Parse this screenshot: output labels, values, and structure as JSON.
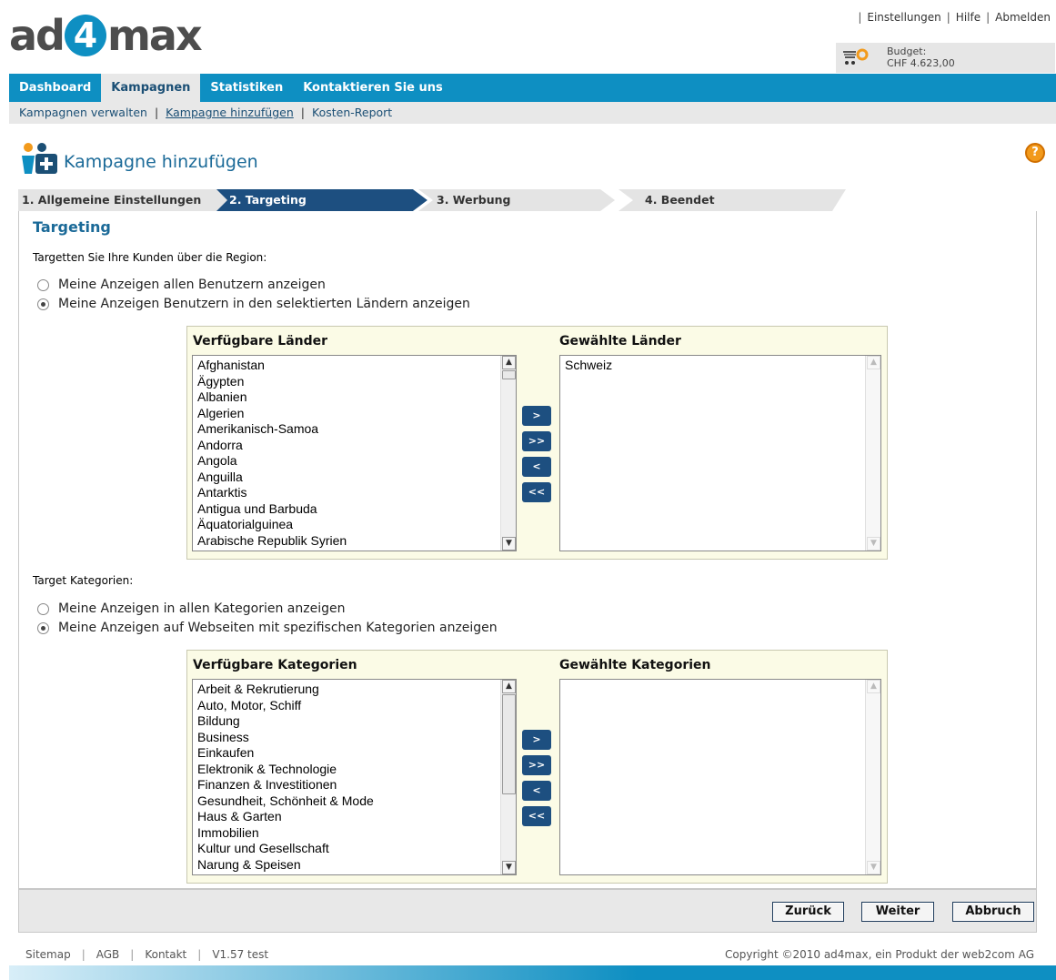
{
  "header": {
    "logo": {
      "pre": "ad",
      "mid": "4",
      "post": "max"
    },
    "toplinks": [
      "Einstellungen",
      "Hilfe",
      "Abmelden"
    ],
    "budget_label": "Budget:",
    "budget_value": "CHF 4.623,00"
  },
  "nav": {
    "items": [
      "Dashboard",
      "Kampagnen",
      "Statistiken",
      "Kontaktieren Sie uns"
    ],
    "active": "Kampagnen"
  },
  "subnav": {
    "items": [
      "Kampagnen verwalten",
      "Kampagne hinzufügen",
      "Kosten-Report"
    ]
  },
  "page": {
    "title": "Kampagne hinzufügen",
    "help": "?"
  },
  "steps": [
    "1. Allgemeine Einstellungen",
    "2. Targeting",
    "3. Werbung",
    "4. Beendet"
  ],
  "targeting": {
    "section_title": "Targeting",
    "region_label": "Targetten Sie Ihre Kunden über die Region:",
    "region_options": [
      "Meine Anzeigen allen Benutzern anzeigen",
      "Meine Anzeigen Benutzern in den selektierten Ländern anzeigen"
    ],
    "countries_available_header": "Verfügbare Länder",
    "countries_selected_header": "Gewählte Länder",
    "countries_available": [
      "Afghanistan",
      "Ägypten",
      "Albanien",
      "Algerien",
      "Amerikanisch-Samoa",
      "Andorra",
      "Angola",
      "Anguilla",
      "Antarktis",
      "Antigua und Barbuda",
      "Äquatorialguinea",
      "Arabische Republik Syrien"
    ],
    "countries_selected": [
      "Schweiz"
    ],
    "category_label": "Target Kategorien:",
    "category_options": [
      "Meine Anzeigen in allen Kategorien anzeigen",
      "Meine Anzeigen auf Webseiten mit spezifischen Kategorien anzeigen"
    ],
    "categories_available_header": "Verfügbare Kategorien",
    "categories_selected_header": "Gewählte Kategorien",
    "categories_available": [
      "Arbeit & Rekrutierung",
      "Auto, Motor, Schiff",
      "Bildung",
      "Business",
      "Einkaufen",
      "Elektronik & Technologie",
      "Finanzen & Investitionen",
      "Gesundheit, Schönheit & Mode",
      "Haus & Garten",
      "Immobilien",
      "Kultur und Gesellschaft",
      "Narung & Speisen"
    ],
    "move_buttons": [
      ">",
      ">>",
      "<",
      "<<"
    ]
  },
  "actions": {
    "back": "Zurück",
    "next": "Weiter",
    "cancel": "Abbruch"
  },
  "footer": {
    "links": [
      "Sitemap",
      "AGB",
      "Kontakt",
      "V1.57 test"
    ],
    "copyright": "Copyright ©2010 ad4max, ein Produkt der web2com AG"
  },
  "colors": {
    "brand": "#0e8fc2",
    "step_active": "#1d4f80",
    "title": "#1b6a98",
    "panel_bg": "#fbfbe6"
  }
}
